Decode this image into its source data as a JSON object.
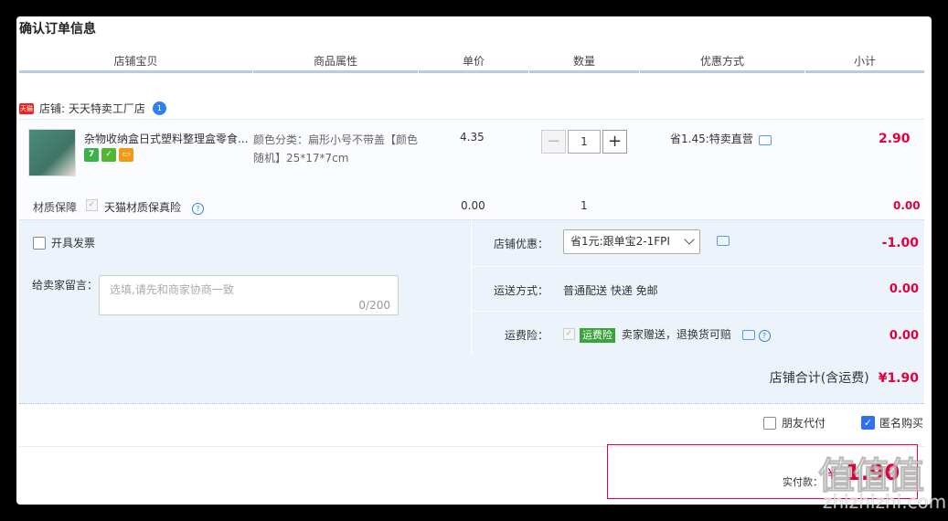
{
  "page_title": "确认订单信息",
  "columns": [
    "店铺宝贝",
    "商品属性",
    "单价",
    "数量",
    "优惠方式",
    "小计"
  ],
  "shop": {
    "badge": "天猫",
    "name": "店铺: 天天特卖工厂店",
    "ww_count": "1"
  },
  "item": {
    "name": "杂物收纳盒日式塑料整理盒零食...",
    "badges": [
      "7",
      "✓",
      "▭"
    ],
    "attr": "颜色分类：扁形小号不带盖【颜色随机】25*17*7cm",
    "unit_price": "4.35",
    "minus": "−",
    "qty": "1",
    "plus": "+",
    "promo": "省1.45:特卖直营",
    "subtotal": "2.90"
  },
  "insurance": {
    "label": "材质保障",
    "check": "✓",
    "name": "天猫材质保真险",
    "help": "?",
    "price": "0.00",
    "qty": "1",
    "subtotal": "0.00"
  },
  "invoice_label": "开具发票",
  "message": {
    "label": "给卖家留言：",
    "placeholder": "选填,请先和商家协商一致",
    "count": "0/200"
  },
  "shop_discount": {
    "label": "店铺优惠：",
    "selected": "省1元:跟单宝2-1FPI",
    "value": "-1.00"
  },
  "shipping": {
    "label": "运送方式：",
    "value_text": "普通配送 快递 免邮",
    "value": "0.00"
  },
  "freight_ins": {
    "label": "运费险：",
    "check": "✓",
    "tag": "运费险",
    "text": "卖家赠送，退换货可赔",
    "help": "?",
    "value": "0.00"
  },
  "store_total": {
    "label": "店铺合计(含运费)",
    "amount": "¥1.90"
  },
  "options": {
    "friend_pay": "朋友代付",
    "anonymous": "匿名购买",
    "check": "✓"
  },
  "payment": {
    "label": "实付款：",
    "currency": "¥",
    "amount": "1.90"
  },
  "watermark": {
    "logo": "值值值",
    "site": "zhizhizhi.com"
  },
  "colors": {
    "accent_red": "#e4003a",
    "header_line": "#b6cbe5",
    "panel_bg": "#edf3fb",
    "checkbox_blue": "#2f6ff0"
  }
}
